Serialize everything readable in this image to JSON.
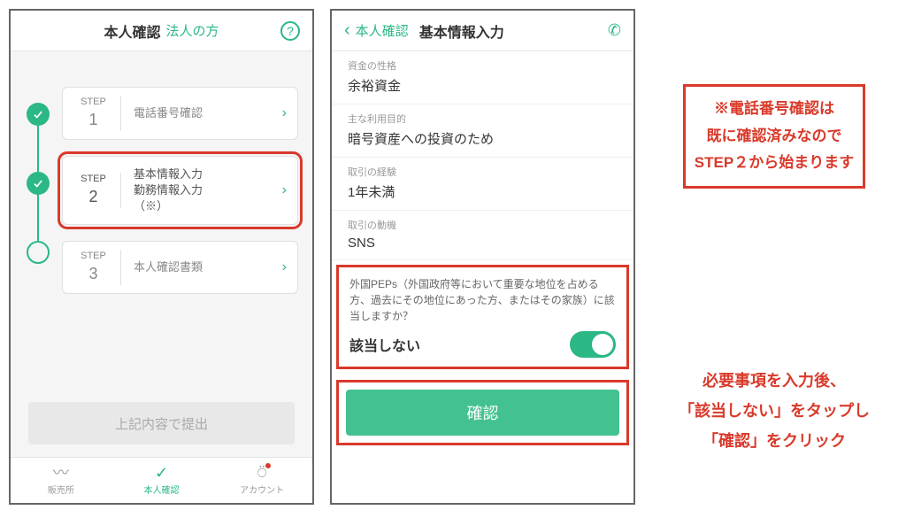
{
  "phone1": {
    "header": {
      "title": "本人確認",
      "sub": "法人の方"
    },
    "steps": [
      {
        "num": "1",
        "label": "電話番号確認",
        "state": "done"
      },
      {
        "num": "2",
        "label": "基本情報入力\n勤務情報入力\n（※）",
        "state": "active"
      },
      {
        "num": "3",
        "label": "本人確認書類",
        "state": "pending"
      }
    ],
    "submit_label": "上記内容で提出",
    "nav": {
      "sales": "販売所",
      "identity": "本人確認",
      "account": "アカウント"
    }
  },
  "phone2": {
    "back": "本人確認",
    "title": "基本情報入力",
    "fields": [
      {
        "lbl": "資金の性格",
        "val": "余裕資金"
      },
      {
        "lbl": "主な利用目的",
        "val": "暗号資産への投資のため"
      },
      {
        "lbl": "取引の経験",
        "val": "1年未満"
      },
      {
        "lbl": "取引の動機",
        "val": "SNS"
      }
    ],
    "peps": {
      "question": "外国PEPs（外国政府等において重要な地位を占める方、過去にその地位にあった方、またはその家族）に該当しますか？",
      "value": "該当しない"
    },
    "confirm_label": "確認"
  },
  "annotations": {
    "note1": "※電話番号確認は\n既に確認済みなので\nSTEP２から始まります",
    "note2": "必要事項を入力後、\n「該当しない」をタップし\n「確認」をクリック"
  }
}
